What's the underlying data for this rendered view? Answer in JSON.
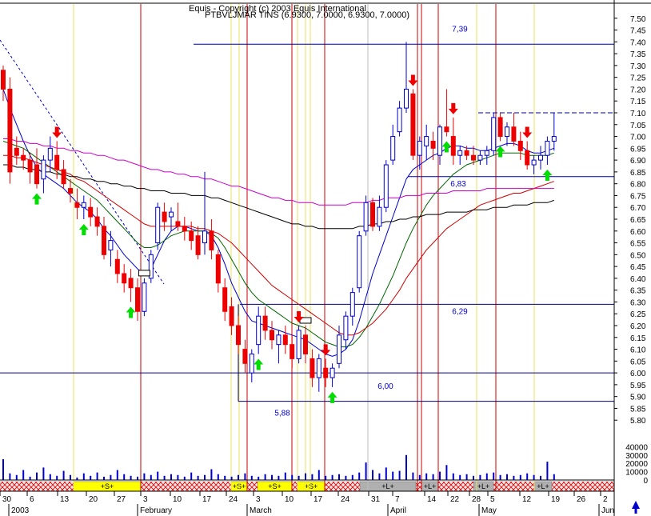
{
  "chart_data": {
    "type": "candlestick",
    "header": {
      "line1": "Equis - Copyright (c) 2003 Equis International",
      "line2": "PTBVLJMAR TINS (6.9300, 7.0000, 6.9300, 7.0000)"
    },
    "price_axis": {
      "min": 5.75,
      "max": 7.55,
      "ticks": [
        "7.50",
        "7.45",
        "7.40",
        "7.35",
        "7.30",
        "7.25",
        "7.20",
        "7.15",
        "7.10",
        "7.05",
        "7.00",
        "6.95",
        "6.90",
        "6.85",
        "6.80",
        "6.75",
        "6.70",
        "6.65",
        "6.60",
        "6.55",
        "6.50",
        "6.45",
        "6.40",
        "6.35",
        "6.30",
        "6.25",
        "6.20",
        "6.15",
        "6.10",
        "6.05",
        "6.00",
        "5.95",
        "5.90",
        "5.85",
        "5.80"
      ]
    },
    "volume_axis": {
      "max": 50000,
      "ticks": [
        "40000",
        "30000",
        "20000",
        "10000",
        "0"
      ]
    },
    "x_axis": {
      "date_ticks": [
        "30",
        "6",
        "13",
        "20",
        "27",
        "3",
        "10",
        "17",
        "24",
        "3",
        "10",
        "17",
        "24",
        "31",
        "7",
        "14",
        "22",
        "28",
        "5",
        "12",
        "19",
        "26",
        "2"
      ],
      "month_labels": [
        "2003",
        "February",
        "March",
        "April",
        "May",
        "Jun"
      ]
    },
    "levels": [
      {
        "label": "7,39",
        "value": 7.39
      },
      {
        "label": "6,83",
        "value": 6.83
      },
      {
        "label": "6,29",
        "value": 6.29
      },
      {
        "label": "6,00",
        "value": 6.0
      },
      {
        "label": "5,88",
        "value": 5.88
      }
    ],
    "resistance_dashed": 7.1,
    "candles": [
      [
        7.28,
        7.3,
        7.15,
        7.2
      ],
      [
        7.2,
        7.25,
        6.8,
        6.85
      ],
      [
        6.95,
        7.0,
        6.88,
        6.92
      ],
      [
        6.92,
        6.95,
        6.86,
        6.9
      ],
      [
        6.9,
        6.93,
        6.8,
        6.85
      ],
      [
        6.88,
        6.95,
        6.78,
        6.8
      ],
      [
        6.82,
        6.92,
        6.76,
        6.9
      ],
      [
        6.9,
        7.0,
        6.85,
        6.95
      ],
      [
        6.92,
        6.98,
        6.82,
        6.86
      ],
      [
        6.86,
        6.9,
        6.78,
        6.8
      ],
      [
        6.78,
        6.82,
        6.72,
        6.76
      ],
      [
        6.72,
        6.78,
        6.65,
        6.7
      ],
      [
        6.7,
        6.75,
        6.65,
        6.72
      ],
      [
        6.7,
        6.74,
        6.62,
        6.66
      ],
      [
        6.66,
        6.7,
        6.58,
        6.62
      ],
      [
        6.62,
        6.66,
        6.48,
        6.5
      ],
      [
        6.52,
        6.6,
        6.45,
        6.56
      ],
      [
        6.48,
        6.52,
        6.38,
        6.42
      ],
      [
        6.42,
        6.46,
        6.34,
        6.38
      ],
      [
        6.4,
        6.44,
        6.3,
        6.36
      ],
      [
        6.36,
        6.4,
        6.22,
        6.26
      ],
      [
        6.26,
        6.4,
        6.24,
        6.38
      ],
      [
        6.4,
        6.52,
        6.38,
        6.5
      ],
      [
        6.55,
        6.72,
        6.52,
        6.7
      ],
      [
        6.68,
        6.72,
        6.6,
        6.64
      ],
      [
        6.66,
        6.7,
        6.6,
        6.68
      ],
      [
        6.64,
        6.72,
        6.6,
        6.62
      ],
      [
        6.62,
        6.66,
        6.56,
        6.6
      ],
      [
        6.6,
        6.64,
        6.52,
        6.56
      ],
      [
        6.58,
        6.62,
        6.48,
        6.5
      ],
      [
        6.55,
        6.85,
        6.5,
        6.6
      ],
      [
        6.6,
        6.65,
        6.48,
        6.52
      ],
      [
        6.5,
        6.52,
        6.34,
        6.38
      ],
      [
        6.36,
        6.4,
        6.22,
        6.26
      ],
      [
        6.28,
        6.32,
        6.16,
        6.2
      ],
      [
        6.2,
        6.24,
        6.08,
        6.12
      ],
      [
        6.1,
        6.14,
        6.0,
        6.04
      ],
      [
        6.0,
        6.1,
        5.96,
        6.08
      ],
      [
        6.12,
        6.28,
        6.08,
        6.24
      ],
      [
        6.24,
        6.28,
        6.14,
        6.18
      ],
      [
        6.18,
        6.22,
        6.1,
        6.14
      ],
      [
        6.12,
        6.18,
        6.04,
        6.16
      ],
      [
        6.16,
        6.2,
        6.08,
        6.12
      ],
      [
        6.12,
        6.16,
        6.02,
        6.06
      ],
      [
        6.06,
        6.2,
        6.04,
        6.18
      ],
      [
        6.16,
        6.2,
        6.04,
        6.08
      ],
      [
        6.06,
        6.1,
        5.94,
        5.98
      ],
      [
        5.98,
        6.08,
        5.92,
        6.06
      ],
      [
        6.02,
        6.06,
        5.94,
        5.98
      ],
      [
        5.98,
        6.04,
        5.94,
        6.02
      ],
      [
        6.04,
        6.2,
        6.02,
        6.16
      ],
      [
        6.14,
        6.26,
        6.1,
        6.24
      ],
      [
        6.24,
        6.36,
        6.2,
        6.34
      ],
      [
        6.36,
        6.6,
        6.34,
        6.58
      ],
      [
        6.6,
        6.75,
        6.58,
        6.72
      ],
      [
        6.72,
        6.74,
        6.6,
        6.62
      ],
      [
        6.62,
        6.75,
        6.6,
        6.7
      ],
      [
        6.7,
        6.9,
        6.68,
        6.88
      ],
      [
        6.9,
        7.05,
        6.88,
        7.0
      ],
      [
        7.02,
        7.15,
        7.0,
        7.12
      ],
      [
        7.12,
        7.4,
        7.1,
        7.2
      ],
      [
        7.18,
        7.2,
        6.9,
        6.92
      ],
      [
        6.92,
        7.0,
        6.86,
        6.98
      ],
      [
        6.96,
        7.05,
        6.9,
        7.0
      ],
      [
        6.98,
        7.02,
        6.9,
        6.95
      ],
      [
        6.92,
        7.05,
        6.88,
        7.04
      ],
      [
        7.04,
        7.2,
        7.0,
        7.02
      ],
      [
        7.0,
        7.08,
        6.88,
        6.92
      ],
      [
        6.92,
        6.96,
        6.88,
        6.94
      ],
      [
        6.94,
        6.96,
        6.9,
        6.92
      ],
      [
        6.92,
        6.96,
        6.88,
        6.9
      ],
      [
        6.9,
        6.94,
        6.88,
        6.92
      ],
      [
        6.92,
        6.96,
        6.88,
        6.94
      ],
      [
        6.94,
        7.1,
        6.92,
        7.08
      ],
      [
        7.08,
        7.1,
        6.98,
        7.0
      ],
      [
        7.0,
        7.06,
        6.96,
        7.04
      ],
      [
        7.04,
        7.1,
        6.96,
        6.98
      ],
      [
        6.98,
        7.02,
        6.9,
        6.94
      ],
      [
        6.94,
        6.98,
        6.86,
        6.88
      ],
      [
        6.88,
        6.92,
        6.84,
        6.9
      ],
      [
        6.9,
        6.96,
        6.86,
        6.92
      ],
      [
        6.92,
        7.0,
        6.88,
        6.98
      ],
      [
        6.98,
        7.1,
        6.94,
        7.0
      ]
    ],
    "ma_series": [
      {
        "color": "#0000cc",
        "values": [
          7.2,
          7.12,
          7.05,
          6.98,
          6.92,
          6.87,
          6.84,
          6.82,
          6.8,
          6.78,
          6.75,
          6.72,
          6.7,
          6.68,
          6.65,
          6.61,
          6.58,
          6.54,
          6.5,
          6.47,
          6.44,
          6.42,
          6.44,
          6.5,
          6.56,
          6.6,
          6.62,
          6.62,
          6.61,
          6.6,
          6.6,
          6.58,
          6.53,
          6.46,
          6.38,
          6.32,
          6.26,
          6.22,
          6.21,
          6.2,
          6.19,
          6.18,
          6.17,
          6.16,
          6.15,
          6.14,
          6.12,
          6.1,
          6.08,
          6.07,
          6.08,
          6.1,
          6.14,
          6.22,
          6.32,
          6.42,
          6.5,
          6.58,
          6.66,
          6.74,
          6.82,
          6.86,
          6.88,
          6.9,
          6.92,
          6.93,
          6.95,
          6.96,
          6.96,
          6.95,
          6.95,
          6.94,
          6.94,
          6.95,
          6.96,
          6.97,
          6.97,
          6.96,
          6.94,
          6.93,
          6.93,
          6.94,
          6.95
        ]
      },
      {
        "color": "#006600",
        "values": [
          6.98,
          6.97,
          6.96,
          6.95,
          6.93,
          6.91,
          6.89,
          6.87,
          6.85,
          6.83,
          6.81,
          6.79,
          6.77,
          6.75,
          6.73,
          6.7,
          6.67,
          6.64,
          6.61,
          6.58,
          6.55,
          6.53,
          6.53,
          6.54,
          6.56,
          6.58,
          6.59,
          6.6,
          6.6,
          6.6,
          6.6,
          6.59,
          6.57,
          6.53,
          6.48,
          6.43,
          6.38,
          6.34,
          6.31,
          6.29,
          6.27,
          6.25,
          6.23,
          6.21,
          6.2,
          6.19,
          6.17,
          6.15,
          6.13,
          6.12,
          6.11,
          6.11,
          6.12,
          6.15,
          6.19,
          6.24,
          6.29,
          6.35,
          6.41,
          6.48,
          6.55,
          6.61,
          6.66,
          6.71,
          6.75,
          6.78,
          6.81,
          6.84,
          6.86,
          6.88,
          6.89,
          6.9,
          6.91,
          6.92,
          6.93,
          6.93,
          6.93,
          6.93,
          6.92,
          6.92,
          6.92,
          6.92,
          6.93
        ]
      },
      {
        "color": "#cc0000",
        "values": [
          6.92,
          6.92,
          6.91,
          6.91,
          6.9,
          6.89,
          6.88,
          6.87,
          6.86,
          6.85,
          6.84,
          6.82,
          6.81,
          6.79,
          6.77,
          6.75,
          6.73,
          6.71,
          6.69,
          6.67,
          6.65,
          6.63,
          6.62,
          6.62,
          6.62,
          6.62,
          6.62,
          6.62,
          6.62,
          6.61,
          6.61,
          6.6,
          6.59,
          6.57,
          6.55,
          6.52,
          6.49,
          6.46,
          6.43,
          6.4,
          6.37,
          6.35,
          6.33,
          6.31,
          6.29,
          6.27,
          6.25,
          6.23,
          6.21,
          6.19,
          6.17,
          6.16,
          6.16,
          6.17,
          6.19,
          6.21,
          6.24,
          6.27,
          6.31,
          6.35,
          6.4,
          6.44,
          6.48,
          6.52,
          6.55,
          6.58,
          6.61,
          6.63,
          6.65,
          6.67,
          6.69,
          6.71,
          6.72,
          6.73,
          6.74,
          6.75,
          6.76,
          6.76,
          6.77,
          6.78,
          6.79,
          6.8,
          6.81
        ]
      },
      {
        "color": "#000000",
        "values": [
          6.88,
          6.88,
          6.87,
          6.87,
          6.86,
          6.86,
          6.85,
          6.85,
          6.84,
          6.84,
          6.83,
          6.83,
          6.82,
          6.82,
          6.81,
          6.81,
          6.8,
          6.8,
          6.79,
          6.79,
          6.78,
          6.78,
          6.77,
          6.77,
          6.77,
          6.76,
          6.76,
          6.76,
          6.75,
          6.75,
          6.75,
          6.74,
          6.74,
          6.73,
          6.72,
          6.71,
          6.7,
          6.69,
          6.68,
          6.67,
          6.66,
          6.65,
          6.64,
          6.63,
          6.63,
          6.62,
          6.62,
          6.61,
          6.61,
          6.61,
          6.61,
          6.61,
          6.61,
          6.62,
          6.62,
          6.63,
          6.63,
          6.64,
          6.64,
          6.65,
          6.65,
          6.66,
          6.66,
          6.67,
          6.67,
          6.67,
          6.68,
          6.68,
          6.68,
          6.68,
          6.69,
          6.69,
          6.69,
          6.7,
          6.7,
          6.7,
          6.71,
          6.71,
          6.71,
          6.72,
          6.72,
          6.72,
          6.73
        ]
      },
      {
        "color": "#cc00cc",
        "values": [
          6.99,
          6.99,
          6.98,
          6.98,
          6.97,
          6.97,
          6.96,
          6.96,
          6.95,
          6.95,
          6.94,
          6.94,
          6.93,
          6.93,
          6.92,
          6.92,
          6.91,
          6.9,
          6.9,
          6.89,
          6.88,
          6.87,
          6.86,
          6.86,
          6.85,
          6.85,
          6.84,
          6.84,
          6.83,
          6.83,
          6.82,
          6.82,
          6.81,
          6.8,
          6.79,
          6.79,
          6.78,
          6.77,
          6.76,
          6.75,
          6.74,
          6.74,
          6.73,
          6.73,
          6.72,
          6.72,
          6.72,
          6.71,
          6.71,
          6.71,
          6.71,
          6.71,
          6.72,
          6.72,
          6.72,
          6.73,
          6.73,
          6.74,
          6.74,
          6.74,
          6.75,
          6.75,
          6.75,
          6.76,
          6.76,
          6.76,
          6.76,
          6.77,
          6.77,
          6.77,
          6.77,
          6.77,
          6.78,
          6.78,
          6.78,
          6.78,
          6.78,
          6.78,
          6.78,
          6.78,
          6.78,
          6.78,
          6.78
        ]
      }
    ],
    "volumes": [
      25000,
      8000,
      6000,
      12000,
      4000,
      9000,
      15000,
      7000,
      5000,
      11000,
      6000,
      3000,
      8000,
      5000,
      9000,
      4000,
      6000,
      12000,
      7000,
      5000,
      4000,
      8000,
      6000,
      10000,
      5000,
      7000,
      6000,
      4000,
      9000,
      5000,
      6000,
      13000,
      7000,
      5000,
      4000,
      6000,
      8000,
      5000,
      4000,
      7000,
      6000,
      5000,
      9000,
      6000,
      5000,
      8000,
      7000,
      12000,
      5000,
      6000,
      7000,
      5000,
      6000,
      9000,
      21000,
      12000,
      8000,
      15000,
      10000,
      11000,
      30000,
      9000,
      6000,
      8000,
      7000,
      10000,
      18000,
      8000,
      6000,
      7000,
      5000,
      6000,
      8000,
      9000,
      6000,
      7000,
      5000,
      6000,
      8000,
      6000,
      5000,
      22000,
      7000
    ],
    "band_labels": [
      "+S+",
      "+S+",
      "+S+",
      "+S+",
      "+L+",
      "+L+",
      "+L+",
      "+L+"
    ],
    "up_arrows_at": [
      5,
      12,
      19,
      38,
      49,
      66,
      74,
      81
    ],
    "down_arrows_at": [
      8,
      44,
      48,
      61,
      67,
      78
    ],
    "marker_boxes_at": [
      21,
      45
    ]
  }
}
